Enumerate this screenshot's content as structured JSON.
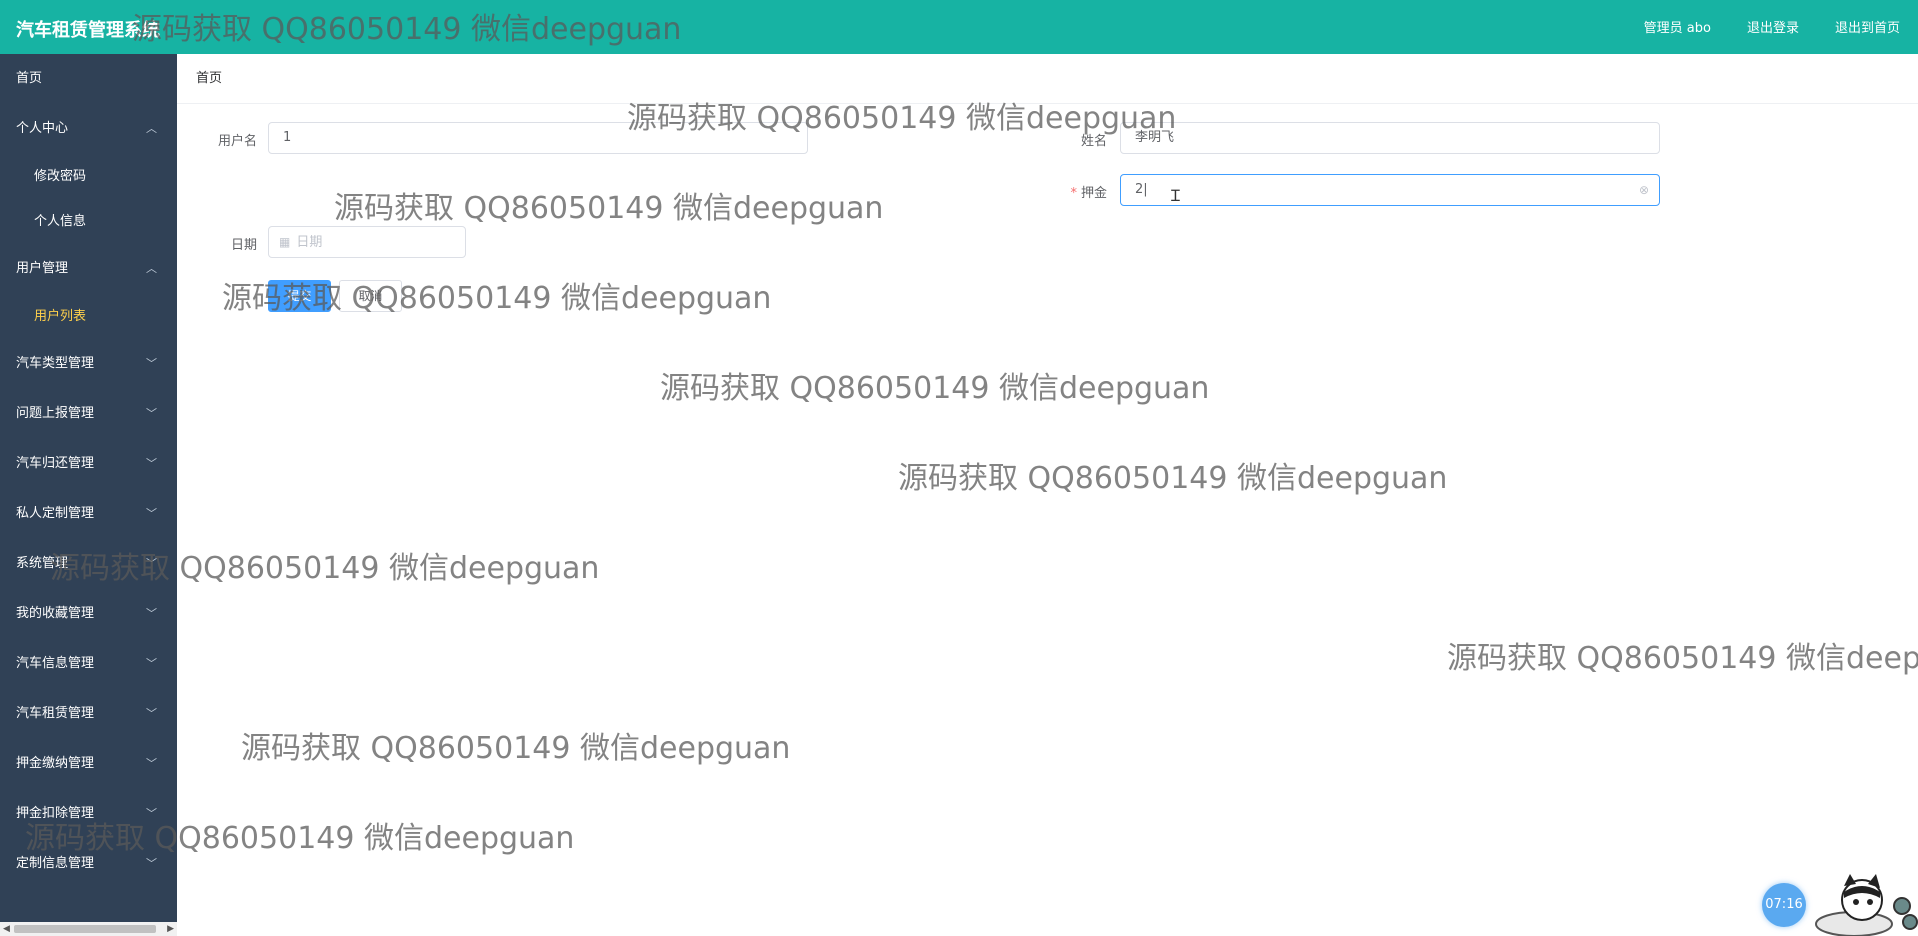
{
  "app": {
    "title": "汽车租赁管理系统"
  },
  "header": {
    "admin_label": "管理员 abo",
    "logout_label": "退出登录",
    "exit_home_label": "退出到首页"
  },
  "sidebar": {
    "home": "首页",
    "personal_center": {
      "label": "个人中心",
      "children": [
        "修改密码",
        "个人信息"
      ]
    },
    "user_mgmt": {
      "label": "用户管理",
      "children": [
        "用户列表"
      ]
    },
    "collapsed": [
      "汽车类型管理",
      "问题上报管理",
      "汽车归还管理",
      "私人定制管理",
      "系统管理",
      "我的收藏管理",
      "汽车信息管理",
      "汽车租赁管理",
      "押金缴纳管理",
      "押金扣除管理",
      "定制信息管理"
    ]
  },
  "breadcrumb": "首页",
  "form": {
    "username": {
      "label": "用户名",
      "value": "1"
    },
    "name": {
      "label": "姓名",
      "value": "李明飞"
    },
    "deposit": {
      "label": "押金",
      "required_mark": "*",
      "value": "2|"
    },
    "date": {
      "label": "日期",
      "placeholder": "日期"
    },
    "submit_label": "提交",
    "cancel_label": "取消"
  },
  "watermark_text": "源码获取 QQ86050149 微信deepguan",
  "timer": "07:16",
  "colors": {
    "header": "#17b3a3",
    "sidebar": "#304156",
    "primary": "#409eff",
    "active_menu": "#ffd04b"
  },
  "icons": [
    "chevron-up-icon",
    "chevron-down-icon",
    "calendar-icon",
    "clear-icon",
    "text-cursor-icon",
    "mascot-cat-icon"
  ]
}
